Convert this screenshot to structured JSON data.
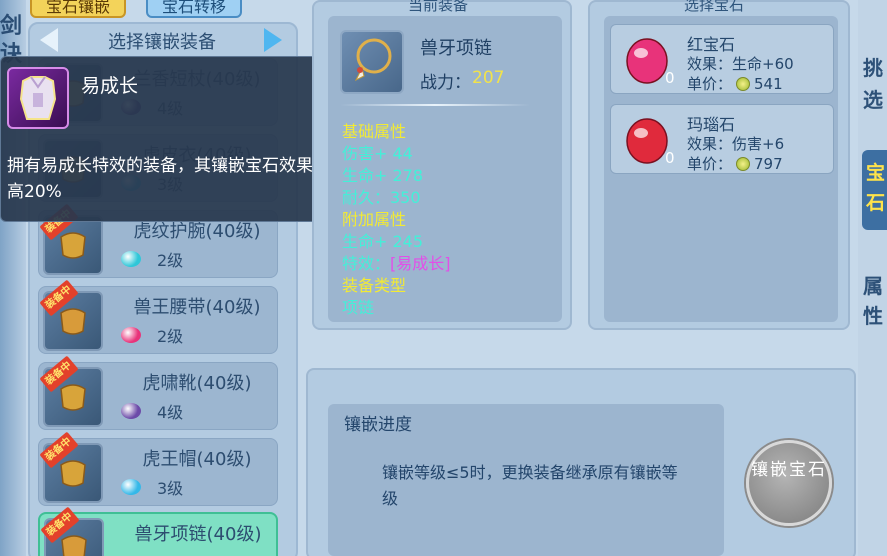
{
  "tabs": {
    "inlay": "宝石镶嵌",
    "transfer": "宝石转移"
  },
  "left_edge_chars": [
    "剑",
    "诀"
  ],
  "equip_list": {
    "title": "选择镶嵌装备",
    "items": [
      {
        "name": "兰香短杖(40级)",
        "level": "4级",
        "gem": "#5a3a8a",
        "equipped": false,
        "selected": false,
        "art": "#c4a24a"
      },
      {
        "name": "虎皮衣(40级)",
        "level": "3级",
        "gem": "#3fb0dd",
        "equipped": false,
        "selected": false,
        "art": "#c4a24a"
      },
      {
        "name": "虎纹护腕(40级)",
        "level": "2级",
        "gem": "#2fc7d8",
        "equipped": true,
        "selected": false,
        "art": "#d8a43a"
      },
      {
        "name": "兽王腰带(40级)",
        "level": "2级",
        "gem": "#e8337a",
        "equipped": true,
        "selected": false,
        "art": "#d89b3a"
      },
      {
        "name": "虎啸靴(40级)",
        "level": "4级",
        "gem": "#6c4aa8",
        "equipped": true,
        "selected": false,
        "art": "#d8a43a"
      },
      {
        "name": "虎王帽(40级)",
        "level": "3级",
        "gem": "#35b8e8",
        "equipped": true,
        "selected": false,
        "art": "#d8a43a"
      },
      {
        "name": "兽牙项链(40级)",
        "level": "",
        "gem": "",
        "equipped": true,
        "selected": true,
        "art": "#d89b3a"
      }
    ],
    "equipped_tag": "装备中"
  },
  "tooltip": {
    "title": "易成长",
    "desc": "拥有易成长特效的装备，其镶嵌宝石效果提高20%"
  },
  "current_equip": {
    "section_title": "当前装备",
    "name": "兽牙项链",
    "power_label": "战力：",
    "power_value": "207",
    "base_header": "基础属性",
    "base_attrs": [
      "伤害+ 44",
      "生命+ 278",
      "耐久：350"
    ],
    "extra_header": "附加属性",
    "extra_attrs": [
      "生命+ 245"
    ],
    "effect_label": "特效：",
    "effect_value": "[易成长]",
    "type_header": "装备类型",
    "type_value": "项链"
  },
  "gem_select": {
    "section_title": "选择宝石",
    "gems": [
      {
        "name": "红宝石",
        "effect": "效果：生命+60",
        "price_label": "单价：",
        "price": "541",
        "qty": "0",
        "color": "#e8337a"
      },
      {
        "name": "玛瑙石",
        "effect": "效果：伤害+6",
        "price_label": "单价：",
        "price": "797",
        "qty": "0",
        "color": "#e02a3c"
      }
    ]
  },
  "progress": {
    "title": "镶嵌进度",
    "text": "镶嵌等级≤5时，更换装备继承原有镶嵌等级"
  },
  "inlay_button": "镶嵌宝石",
  "right_edge_chars": [
    "挑",
    "选",
    "宝",
    "石",
    "属",
    "性"
  ]
}
